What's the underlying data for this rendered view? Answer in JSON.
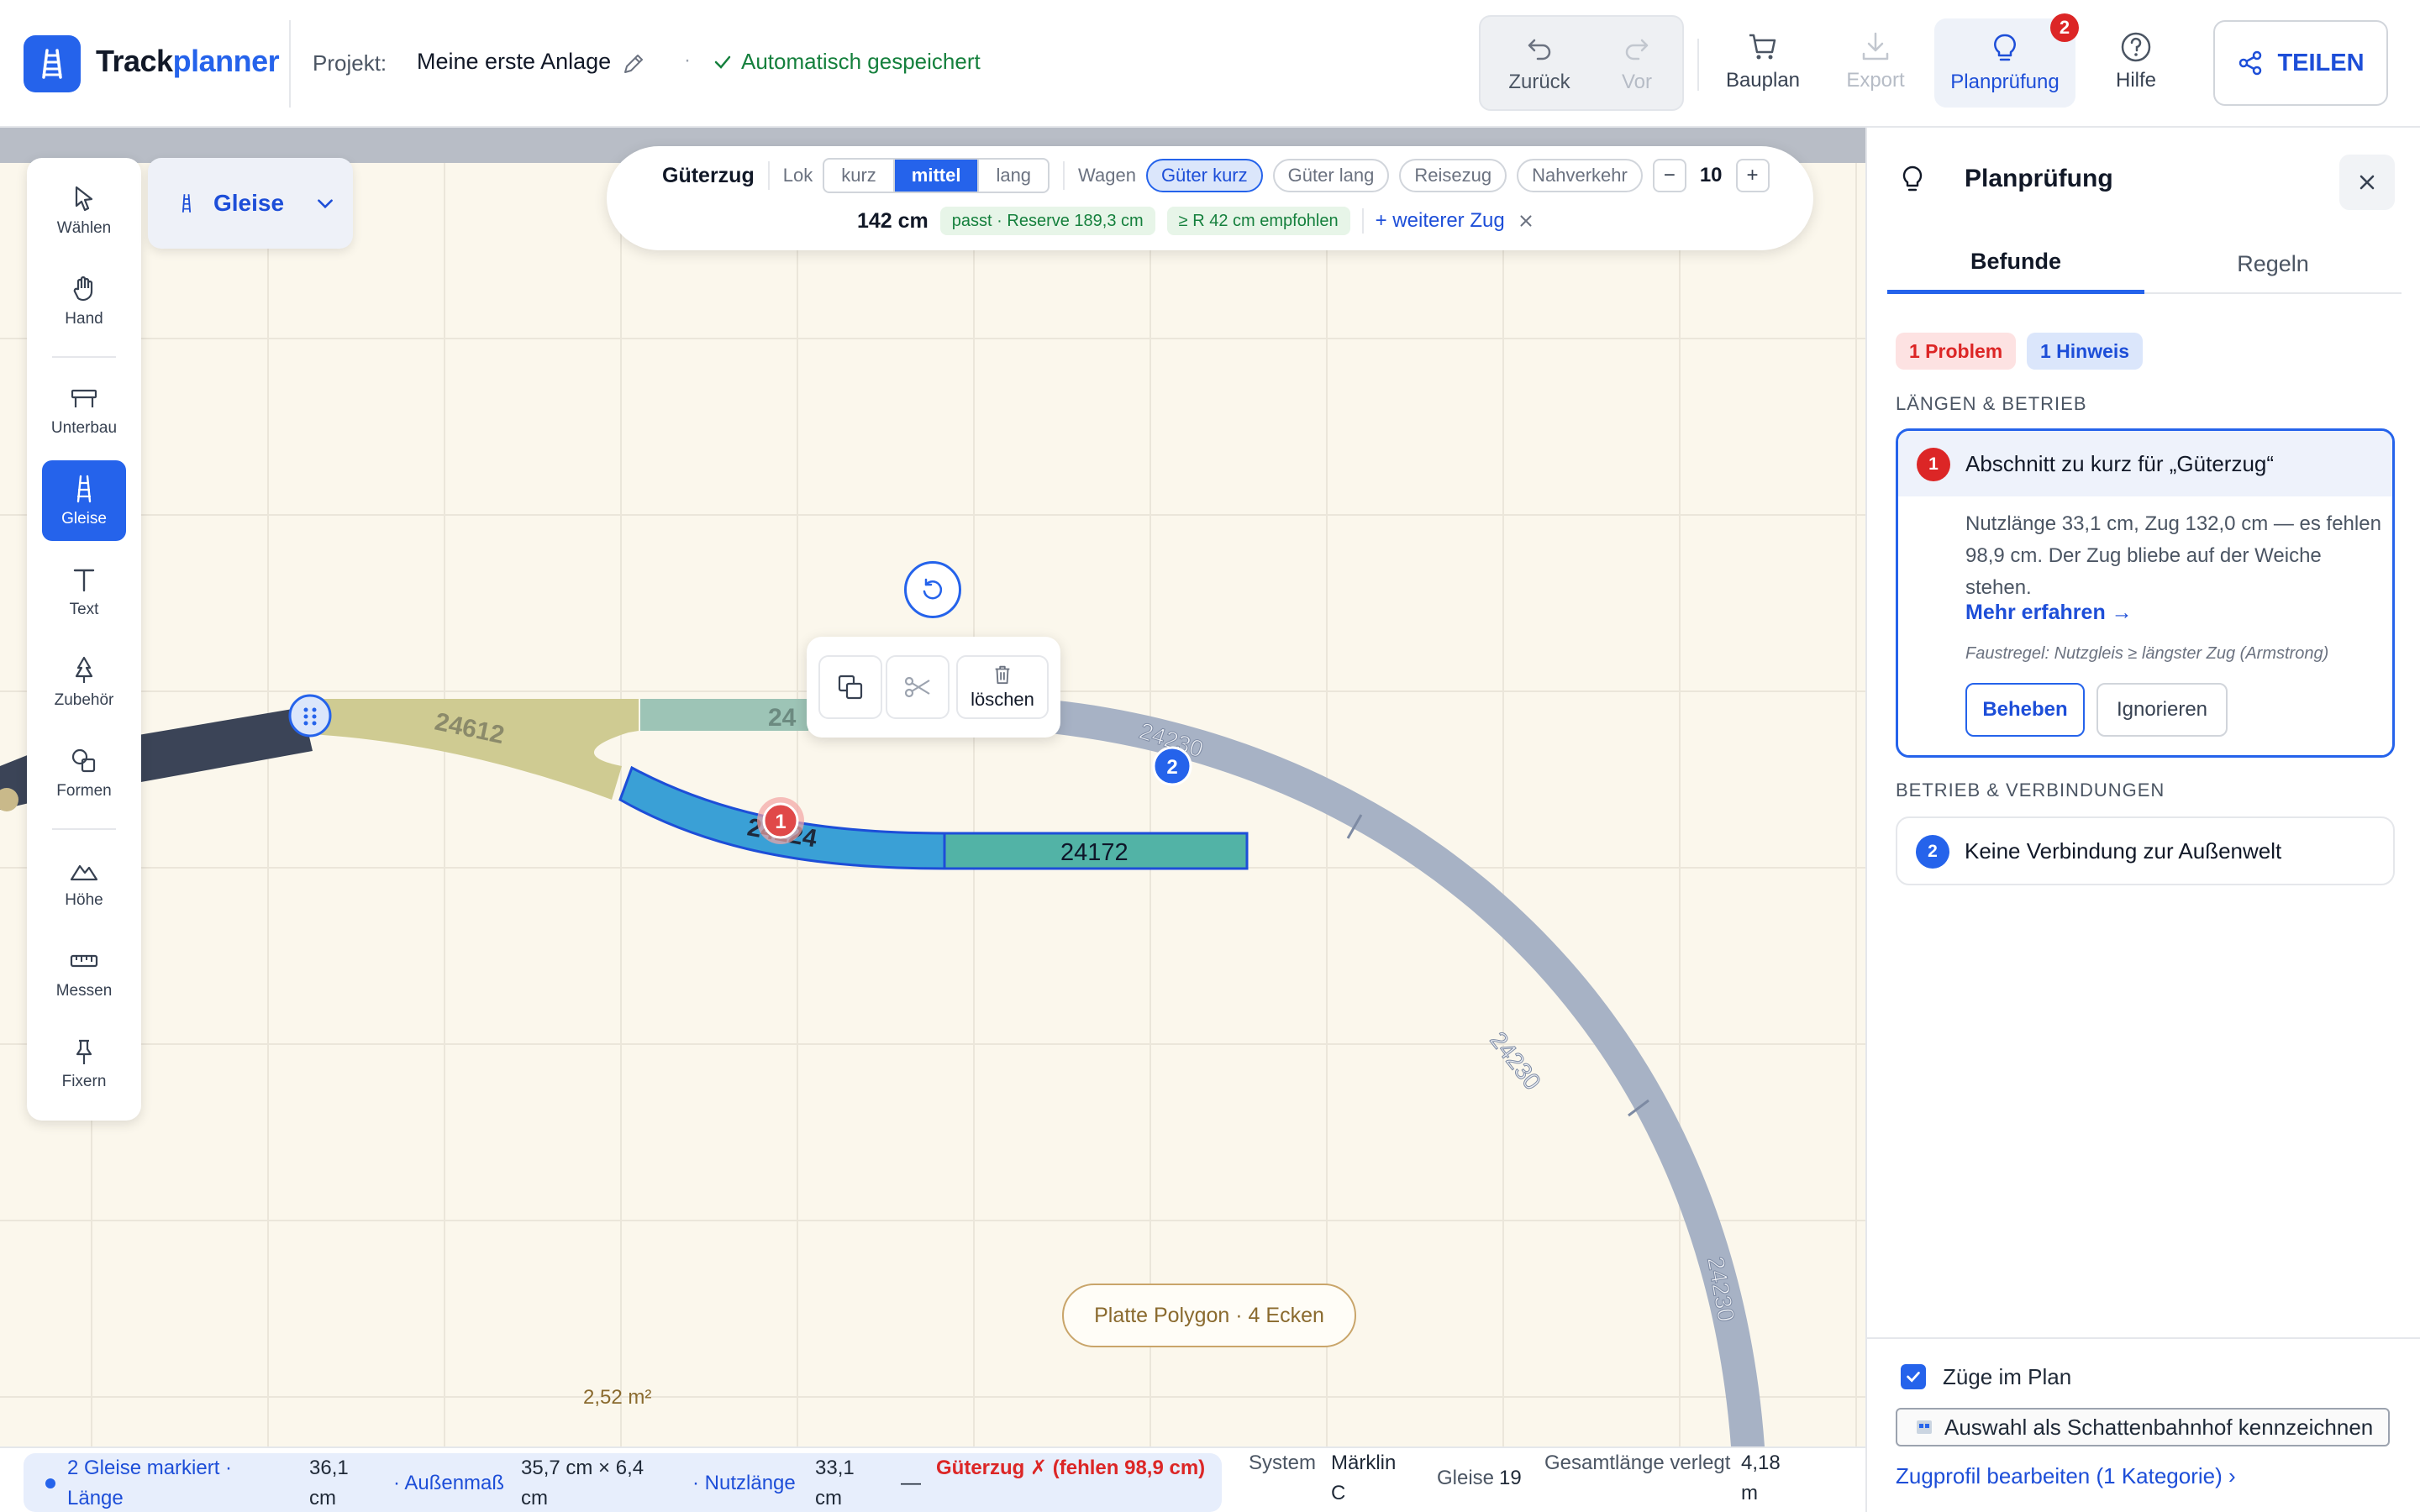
{
  "header": {
    "brand_prefix": "Track",
    "brand_suffix": "planner",
    "project_label": "Projekt:",
    "project_name": "Meine erste Anlage",
    "separator": "·",
    "save_status": "Automatisch gespeichert",
    "undo_label": "Zurück",
    "redo_label": "Vor",
    "bauplan_label": "Bauplan",
    "export_label": "Export",
    "planpruefung_label": "Planprüfung",
    "planpruefung_badge": "2",
    "hilfe_label": "Hilfe",
    "share_label": "TEILEN"
  },
  "palette": {
    "tools": [
      {
        "label": "Wählen",
        "icon": "cursor-icon"
      },
      {
        "label": "Hand",
        "icon": "hand-icon"
      },
      {
        "label": "Unterbau",
        "icon": "table-icon"
      },
      {
        "label": "Gleise",
        "icon": "track-icon",
        "active": true
      },
      {
        "label": "Text",
        "icon": "text-icon"
      },
      {
        "label": "Zubehör",
        "icon": "tree-icon"
      },
      {
        "label": "Formen",
        "icon": "shapes-icon"
      },
      {
        "label": "Höhe",
        "icon": "mountain-icon"
      },
      {
        "label": "Messen",
        "icon": "ruler-icon"
      },
      {
        "label": "Fixern",
        "icon": "pin-icon"
      }
    ]
  },
  "layer_dropdown": {
    "label": "Gleise"
  },
  "train": {
    "name": "Güterzug",
    "lok_label": "Lok",
    "lok_options": [
      "kurz",
      "mittel",
      "lang"
    ],
    "lok_selected": "mittel",
    "wagen_label": "Wagen",
    "wagen_options": [
      "Güter kurz",
      "Güter lang",
      "Reisezug",
      "Nahverkehr"
    ],
    "wagen_selected": "Güter kurz",
    "count": "10",
    "minus": "−",
    "plus": "+",
    "length": "142 cm",
    "fit_chip": "passt · Reserve 189,3 cm",
    "radius_chip": "≥ R 42 cm empfohlen",
    "add_train": "+ weiterer Zug"
  },
  "canvas": {
    "track_labels": [
      "24612",
      "24",
      "24224",
      "24172",
      "24230",
      "24230",
      "24230"
    ],
    "markers": [
      "1",
      "2"
    ],
    "context_delete": "löschen",
    "platte_label": "Platte Polygon · 4 Ecken",
    "area_label": "2,52 m²"
  },
  "status": {
    "selection": "2 Gleise markiert · Länge",
    "length_val": "36,1 cm",
    "outer_label": "· Außenmaß",
    "outer_val": "35,7 cm × 6,4 cm",
    "usable_label": "· Nutzlänge",
    "usable_val": "33,1 cm",
    "dash": "—",
    "train_fail": "Güterzug ✗ (fehlen 98,9 cm)",
    "system_label": "System",
    "system_val": "Märklin C",
    "gleise_label": "Gleise",
    "gleise_val": "19",
    "total_label": "Gesamtlänge verlegt",
    "total_val": "4,18 m"
  },
  "panel": {
    "title": "Planprüfung",
    "tabs": [
      "Befunde",
      "Regeln"
    ],
    "problem_count": "1 Problem",
    "hint_count": "1 Hinweis",
    "section1": "LÄNGEN & BETRIEB",
    "finding1": {
      "num": "1",
      "title": "Abschnitt zu kurz für „Güterzug“",
      "body": "Nutzlänge 33,1 cm, Zug 132,0 cm — es fehlen 98,9 cm. Der Zug bliebe auf der Weiche stehen.",
      "more": "Mehr erfahren →",
      "hint": "Faustregel: Nutzgleis ≥ längster Zug (Armstrong)",
      "fix": "Beheben",
      "ignore": "Ignorieren"
    },
    "section2": "BETRIEB & VERBINDUNGEN",
    "finding2": {
      "num": "2",
      "title": "Keine Verbindung zur Außenwelt"
    },
    "trains_in_plan": "Züge im Plan",
    "shadow_station": "Auswahl als Schattenbahnhof kennzeichnen",
    "profile_link": "Zugprofil bearbeiten (1 Kategorie) ›"
  },
  "colors": {
    "accent": "#2563eb",
    "success": "#15803d",
    "danger": "#dc2626",
    "track_selected": "#3aa0d6",
    "track_teal": "#52b3a6",
    "track_khaki": "#cfcb92",
    "track_grey": "#a7b2c5"
  }
}
